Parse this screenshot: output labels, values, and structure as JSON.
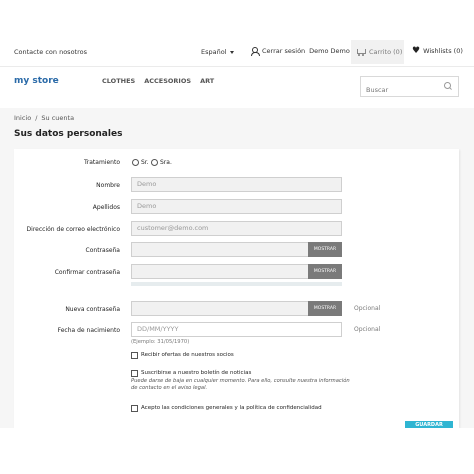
{
  "header": {
    "contact": "Contacte con nosotros",
    "language": "Español",
    "logout": "Cerrar sesión",
    "username": "Demo Demo",
    "cart": "Carrito (0)",
    "wishlists": "Wishlists (0)"
  },
  "logo": {
    "my": "my",
    "store": "store"
  },
  "nav": [
    "CLOTHES",
    "ACCESORIOS",
    "ART"
  ],
  "search": {
    "placeholder": "Buscar"
  },
  "breadcrumb": {
    "home": "Inicio",
    "separator": "/",
    "current": "Su cuenta"
  },
  "page_title": "Sus datos personales",
  "form": {
    "title_label": "Tratamiento",
    "title_options": [
      "Sr.",
      "Sra."
    ],
    "firstname_label": "Nombre",
    "firstname_value": "Demo",
    "lastname_label": "Apellidos",
    "lastname_value": "Demo",
    "email_label": "Dirección de correo electrónico",
    "email_value": "customer@demo.com",
    "password_label": "Contraseña",
    "confirm_password_label": "Confirmar contraseña",
    "new_password_label": "Nueva contraseña",
    "birthday_label": "Fecha de nacimiento",
    "birthday_placeholder": "DD/MM/YYYY",
    "birthday_hint": "(Ejemplo: 31/05/1970)",
    "show_label": "MOSTRAR",
    "optional": "Opcional",
    "offers_label": "Recibir ofertas de nuestros socios",
    "newsletter_label": "Suscribirse a nuestro boletín de noticias",
    "newsletter_note": "Puede darse de baja en cualquier momento. Para ello, consulte nuestra información de contacto en el aviso legal.",
    "terms_label": "Acepto las condiciones generales y la política de confidencialidad",
    "save_label": "GUARDAR"
  },
  "colors": {
    "accent": "#2fb5d2",
    "logo": "#2a6aa8",
    "logo_accent": "#f39a2e"
  }
}
